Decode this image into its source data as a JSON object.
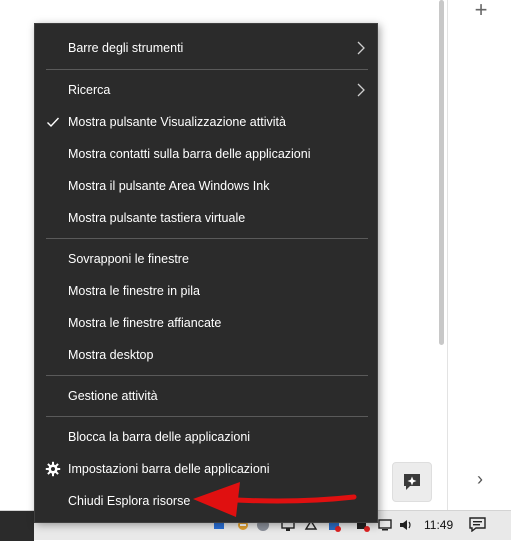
{
  "menu": {
    "items": [
      {
        "id": "toolbars",
        "label": "Barre degli strumenti",
        "submenu": true,
        "checked": false
      },
      {
        "id": "search",
        "label": "Ricerca",
        "submenu": true,
        "checked": false
      },
      {
        "id": "taskview",
        "label": "Mostra pulsante Visualizzazione attività",
        "submenu": false,
        "checked": true
      },
      {
        "id": "contacts",
        "label": "Mostra contatti sulla barra delle applicazioni",
        "submenu": false,
        "checked": false
      },
      {
        "id": "ink",
        "label": "Mostra il pulsante Area Windows Ink",
        "submenu": false,
        "checked": false
      },
      {
        "id": "keyboard",
        "label": "Mostra pulsante tastiera virtuale",
        "submenu": false,
        "checked": false
      },
      {
        "id": "cascade",
        "label": "Sovrapponi le finestre",
        "submenu": false,
        "checked": false
      },
      {
        "id": "stack",
        "label": "Mostra le finestre in pila",
        "submenu": false,
        "checked": false
      },
      {
        "id": "sidebyside",
        "label": "Mostra le finestre affiancate",
        "submenu": false,
        "checked": false
      },
      {
        "id": "desktop",
        "label": "Mostra desktop",
        "submenu": false,
        "checked": false
      },
      {
        "id": "taskmgr",
        "label": "Gestione attività",
        "submenu": false,
        "checked": false
      },
      {
        "id": "lock",
        "label": "Blocca la barra delle applicazioni",
        "submenu": false,
        "checked": false
      },
      {
        "id": "settings",
        "label": "Impostazioni barra delle applicazioni",
        "submenu": false,
        "checked": false,
        "icon": "gear-icon"
      },
      {
        "id": "exit_explorer",
        "label": "Chiudi Esplora risorse",
        "submenu": false,
        "checked": false
      }
    ]
  },
  "taskbar": {
    "clock": "11:49"
  },
  "colors": {
    "menu_bg": "#2b2b2b",
    "menu_text": "#ffffff",
    "separator": "#5a5a5a",
    "annotation_arrow": "#e01010"
  }
}
